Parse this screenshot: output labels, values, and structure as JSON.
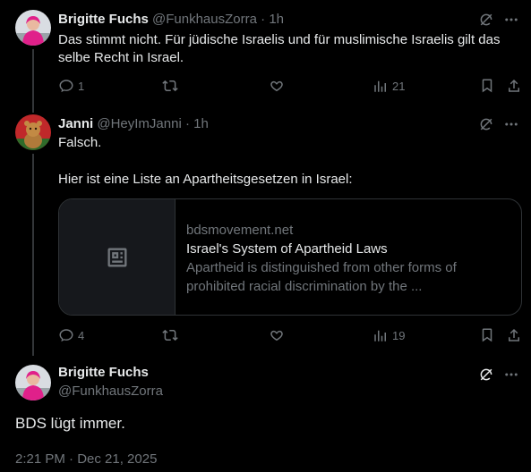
{
  "tweets": [
    {
      "name": "Brigitte Fuchs",
      "handle": "@FunkhausZorra",
      "time": "1h",
      "text": "Das stimmt nicht. Für jüdische Israelis und für muslimische Israelis gilt das selbe Recht in Israel.",
      "replies": "1",
      "reposts": "",
      "likes": "",
      "views": "21"
    },
    {
      "name": "Janni",
      "handle": "@HeyImJanni",
      "time": "1h",
      "text_line1": "Falsch.",
      "text_line2": "Hier ist eine Liste an Apartheitsgesetzen in Israel:",
      "card": {
        "domain": "bdsmovement.net",
        "title": "Israel's System of Apartheid Laws",
        "description": "Apartheid is distinguished from other forms of prohibited racial discrimination by the ..."
      },
      "replies": "4",
      "reposts": "",
      "likes": "",
      "views": "19"
    }
  ],
  "main": {
    "name": "Brigitte Fuchs",
    "handle": "@FunkhausZorra",
    "text": "BDS lügt immer.",
    "timestamp": "2:21 PM · Dec 21, 2025"
  },
  "separator": " · ",
  "colors": {
    "background": "#000000",
    "text": "#e7e9ea",
    "muted": "#71767b",
    "border": "#2f3336",
    "thread_line": "#333639",
    "avatar1": "#e0208a",
    "avatar2": "#c0282a"
  },
  "icons": [
    "grok-icon",
    "more-icon",
    "reply-icon",
    "repost-icon",
    "like-icon",
    "views-icon",
    "bookmark-icon",
    "share-icon",
    "article-icon"
  ]
}
